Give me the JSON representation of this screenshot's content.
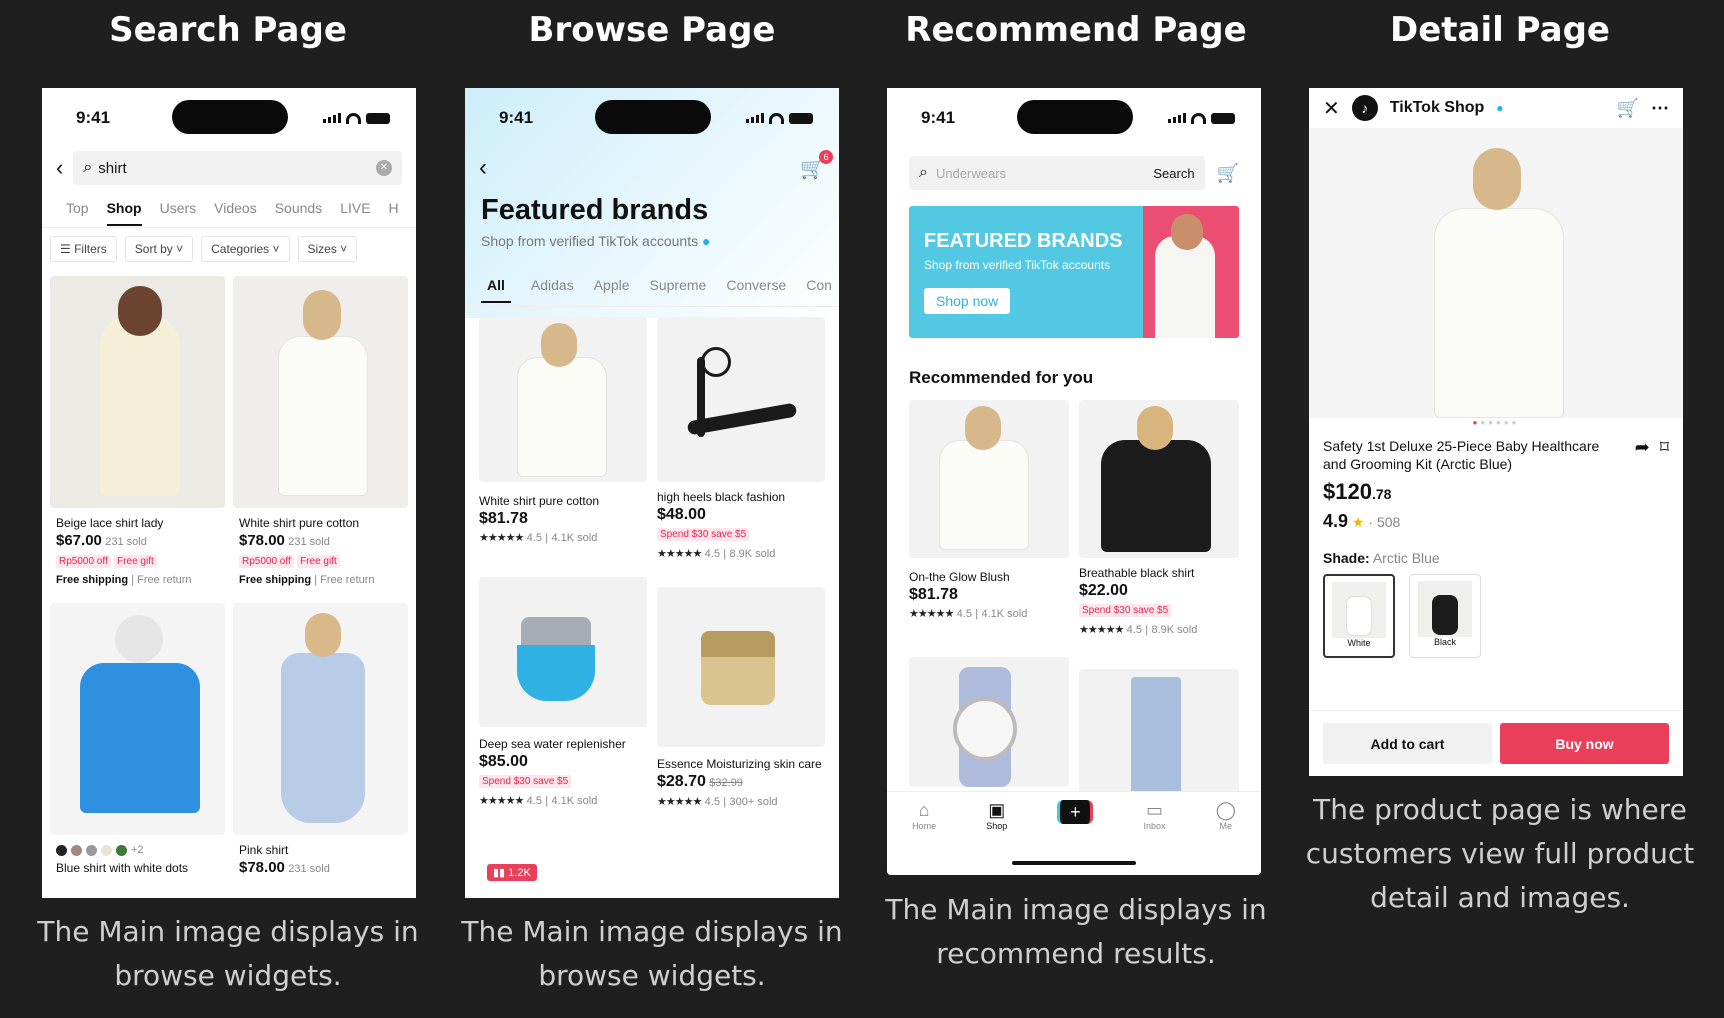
{
  "titles": {
    "search": "Search Page",
    "browse": "Browse Page",
    "recommend": "Recommend Page",
    "detail": "Detail Page"
  },
  "captions": {
    "search": "The Main image displays in browse widgets.",
    "browse": "The Main image displays in browse widgets.",
    "recommend": "The Main image displays in recommend results.",
    "detail": "The product page is where customers view full product detail and images."
  },
  "status": {
    "time": "9:41"
  },
  "search_page": {
    "query": "shirt",
    "tabs": [
      "Top",
      "Shop",
      "Users",
      "Videos",
      "Sounds",
      "LIVE",
      "H"
    ],
    "active_tab": "Shop",
    "filters": [
      "Filters",
      "Sort by",
      "Categories",
      "Sizes"
    ],
    "products": [
      {
        "name": "Beige lace shirt lady",
        "price": "$67.00",
        "sold": "231 sold",
        "promo1": "Rp5000 off",
        "promo2": "Free gift",
        "ship": "Free shipping",
        "ret": "Free return"
      },
      {
        "name": "White shirt pure cotton",
        "price": "$78.00",
        "sold": "231 sold",
        "promo1": "Rp5000 off",
        "promo2": "Free gift",
        "ship": "Free shipping",
        "ret": "Free return"
      },
      {
        "name": "Blue shirt with white dots",
        "more": "+2"
      },
      {
        "name": "Pink shirt",
        "price": "$78.00",
        "sold": "231 sold"
      }
    ]
  },
  "browse_page": {
    "title": "Featured brands",
    "subtitle": "Shop from verified TikTok accounts",
    "cart_badge": "6",
    "tabs": [
      "All",
      "Adidas",
      "Apple",
      "Supreme",
      "Converse",
      "Con"
    ],
    "products": [
      {
        "name": "White shirt pure cotton",
        "price": "$81.78",
        "rating": "4.5",
        "sold": "4.1K sold"
      },
      {
        "name": "high heels black fashion",
        "price": "$48.00",
        "promo": "Spend $30 save $5",
        "rating": "4.5",
        "sold": "8.9K sold"
      },
      {
        "name": "Deep sea water replenisher",
        "price": "$85.00",
        "promo": "Spend $30 save $5",
        "rating": "4.5",
        "sold": "4.1K sold"
      },
      {
        "name": "Essence Moisturizing skin care",
        "price": "$28.70",
        "old_price": "$32.99",
        "rating": "4.5",
        "sold": "300+ sold"
      }
    ],
    "live_count": "1.2K"
  },
  "recommend_page": {
    "search_placeholder": "Underwears",
    "search_button": "Search",
    "banner_title": "FEATURED BRANDS",
    "banner_sub": "Shop from verified TikTok accounts",
    "banner_button": "Shop now",
    "section_title": "Recommended for you",
    "products": [
      {
        "name": "On-the Glow Blush",
        "price": "$81.78",
        "rating": "4.5",
        "sold": "4.1K sold"
      },
      {
        "name": "Breathable black shirt",
        "price": "$22.00",
        "promo": "Spend $30 save $5",
        "rating": "4.5",
        "sold": "8.9K sold"
      }
    ],
    "nav": [
      "Home",
      "Shop",
      "",
      "Inbox",
      "Me"
    ]
  },
  "detail_page": {
    "shop_name": "TikTok Shop",
    "product_title": "Safety 1st Deluxe 25-Piece Baby Healthcare and Grooming Kit (Arctic Blue)",
    "price_main": "$120",
    "price_cents": ".78",
    "rating": "4.9",
    "reviews": "508",
    "shade_label": "Shade:",
    "shade_value": "Arctic Blue",
    "shades": [
      "White",
      "Black"
    ],
    "add_to_cart": "Add to cart",
    "buy_now": "Buy now"
  },
  "colors": {
    "accent": "#ea3f5a",
    "banner_blue": "#52c8e3",
    "banner_pink": "#ec4e72"
  }
}
